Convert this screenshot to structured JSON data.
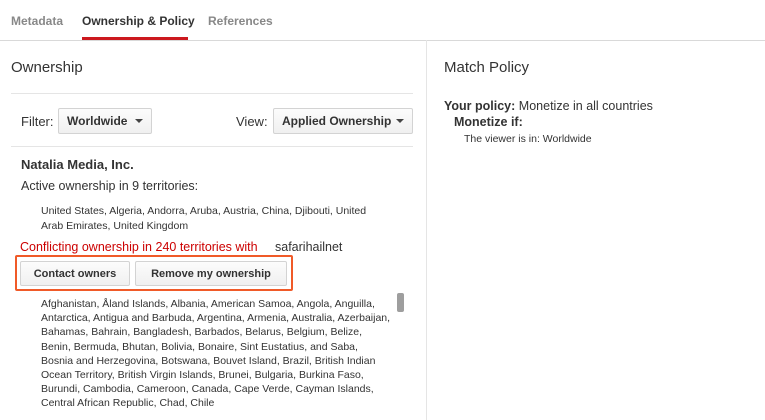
{
  "tabs": [
    {
      "label": "Metadata",
      "active": false
    },
    {
      "label": "Ownership & Policy",
      "active": true
    },
    {
      "label": "References",
      "active": false
    }
  ],
  "ownership": {
    "title": "Ownership",
    "filter_label": "Filter:",
    "filter_value": "Worldwide",
    "view_label": "View:",
    "view_value": "Applied Ownership",
    "owner_name": "Natalia Media, Inc.",
    "active_text": "Active ownership in 9 territories:",
    "active_territories": "United States, Algeria, Andorra, Aruba, Austria, China, Djibouti, United Arab Emirates, United Kingdom",
    "conflict_text": "Conflicting ownership in 240 territories with",
    "conflict_user": "safarihailnet",
    "contact_button": "Contact owners",
    "remove_button": "Remove my ownership",
    "conflict_territories": "Afghanistan, Åland Islands, Albania, American Samoa, Angola, Anguilla, Antarctica, Antigua and Barbuda, Argentina, Armenia, Australia, Azerbaijan, Bahamas, Bahrain, Bangladesh, Barbados, Belarus, Belgium, Belize, Benin, Bermuda, Bhutan, Bolivia, Bonaire, Sint Eustatius, and Saba, Bosnia and Herzegovina, Botswana, Bouvet Island, Brazil, British Indian Ocean Territory, British Virgin Islands, Brunei, Bulgaria, Burkina Faso, Burundi, Cambodia, Cameroon, Canada, Cape Verde, Cayman Islands, Central African Republic, Chad, Chile"
  },
  "policy": {
    "title": "Match Policy",
    "your_policy_label": "Your policy:",
    "your_policy_value": "Monetize in all countries",
    "monetize_if": "Monetize if:",
    "condition": "The viewer is in: Worldwide"
  },
  "colors": {
    "tab_underline": "#cc181e",
    "conflict_red": "#cc0000",
    "highlight_orange": "#f05a28"
  }
}
